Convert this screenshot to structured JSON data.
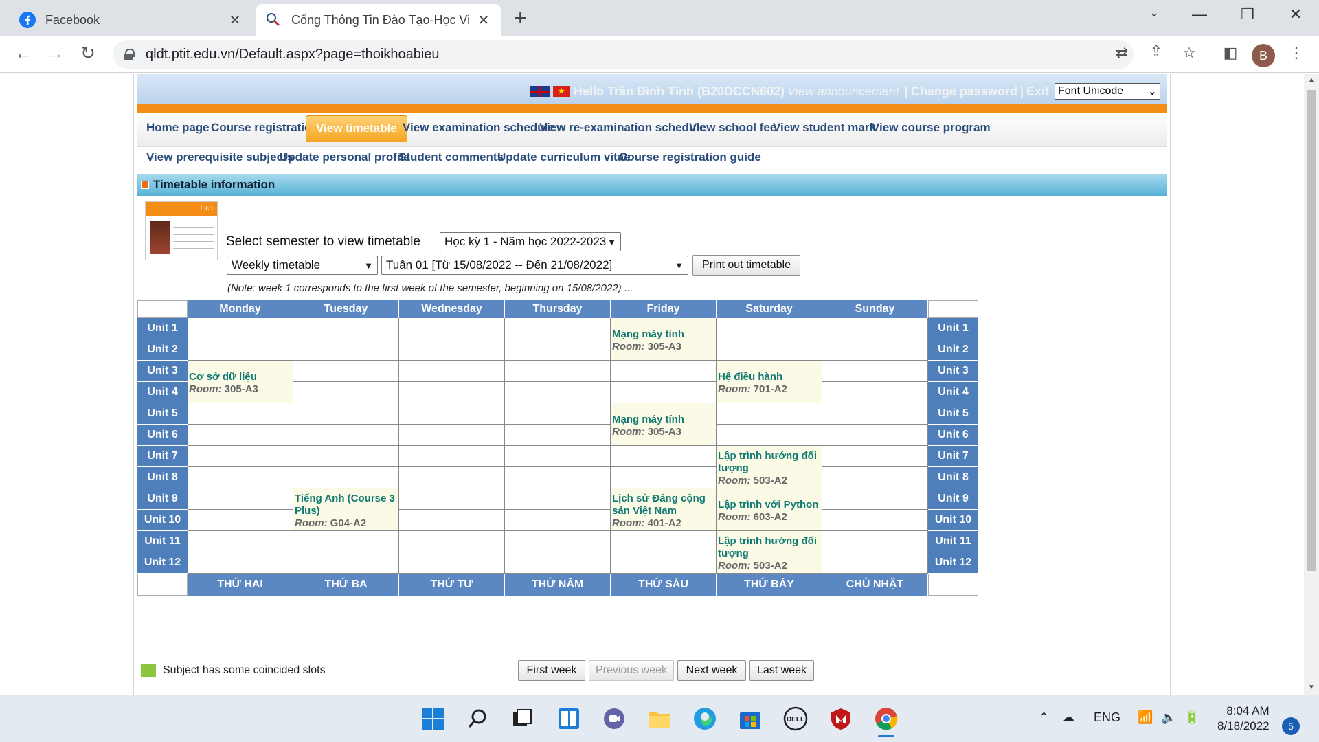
{
  "browser": {
    "tabs": [
      {
        "title": "Facebook",
        "favicon": "facebook-icon"
      },
      {
        "title": "Cổng Thông Tin Đào Tạo-Học Vi",
        "favicon": "ptit-icon"
      }
    ],
    "url": "qldt.ptit.edu.vn/Default.aspx?page=thoikhoabieu",
    "profile_initial": "B"
  },
  "header": {
    "greeting": "Hello Trần Đình Tĩnh (B20DCCN602)",
    "view_announcement": "View announcement",
    "sep": "|",
    "change_password": "Change password",
    "exit": "Exit",
    "font_select": "Font Unicode"
  },
  "menu": {
    "row1": [
      "Home page",
      "Course registration",
      "View timetable",
      "View examination schedule",
      "View re-examination schedule",
      "View school fee",
      "View student mark",
      "View course program"
    ],
    "row2": [
      "View prerequisite subjects",
      "Update personal profile",
      "Student comments",
      "Update curriculum vitae",
      "Course registration guide"
    ],
    "active": "View timetable"
  },
  "timetable_section": {
    "title": "Timetable information",
    "calendar_label": "Lịch",
    "select_semester_label": "Select semester to view timetable",
    "semester_value": "Học kỳ 1 - Năm học 2022-2023",
    "view_type_value": "Weekly timetable",
    "week_value": "Tuần 01 [Từ 15/08/2022 -- Đến 21/08/2022]",
    "print_button": "Print out timetable",
    "note": "(Note: week 1 corresponds to the first week of the semester, beginning on 15/08/2022) ..."
  },
  "timetable": {
    "days_en": [
      "Monday",
      "Tuesday",
      "Wednesday",
      "Thursday",
      "Friday",
      "Saturday",
      "Sunday"
    ],
    "days_vi": [
      "THỨ HAI",
      "THỨ BA",
      "THỨ TƯ",
      "THỨ NĂM",
      "THỨ SÁU",
      "THỨ BẢY",
      "CHỦ NHẬT"
    ],
    "units": [
      "Unit 1",
      "Unit 2",
      "Unit 3",
      "Unit 4",
      "Unit 5",
      "Unit 6",
      "Unit 7",
      "Unit 8",
      "Unit 9",
      "Unit 10",
      "Unit 11",
      "Unit 12"
    ],
    "room_label": "Room:",
    "courses": [
      {
        "day": 4,
        "start": 1,
        "span": 2,
        "name": "Mạng máy tính",
        "room": "305-A3"
      },
      {
        "day": 0,
        "start": 3,
        "span": 2,
        "name": "Cơ sở dữ liệu",
        "room": "305-A3"
      },
      {
        "day": 5,
        "start": 3,
        "span": 2,
        "name": "Hệ điều hành",
        "room": "701-A2"
      },
      {
        "day": 4,
        "start": 5,
        "span": 2,
        "name": "Mạng máy tính",
        "room": "305-A3"
      },
      {
        "day": 5,
        "start": 7,
        "span": 2,
        "name": "Lập trình hướng đối tượng",
        "room": "503-A2"
      },
      {
        "day": 1,
        "start": 9,
        "span": 2,
        "name": "Tiếng Anh (Course 3 Plus)",
        "room": "G04-A2"
      },
      {
        "day": 4,
        "start": 9,
        "span": 2,
        "name": "Lịch sử Đảng cộng sản Việt Nam",
        "room": "401-A2"
      },
      {
        "day": 5,
        "start": 9,
        "span": 2,
        "name": "Lập trình với Python",
        "room": "603-A2"
      },
      {
        "day": 5,
        "start": 11,
        "span": 2,
        "name": "Lập trình hướng đối tượng",
        "room": "503-A2"
      }
    ]
  },
  "nav_buttons": {
    "first": "First week",
    "previous": "Previous week",
    "next": "Next week",
    "last": "Last week"
  },
  "legend": {
    "coincided": "Subject has some coincided slots"
  },
  "taskbar": {
    "language": "ENG",
    "time": "8:04 AM",
    "date": "8/18/2022",
    "notifications": "5"
  }
}
